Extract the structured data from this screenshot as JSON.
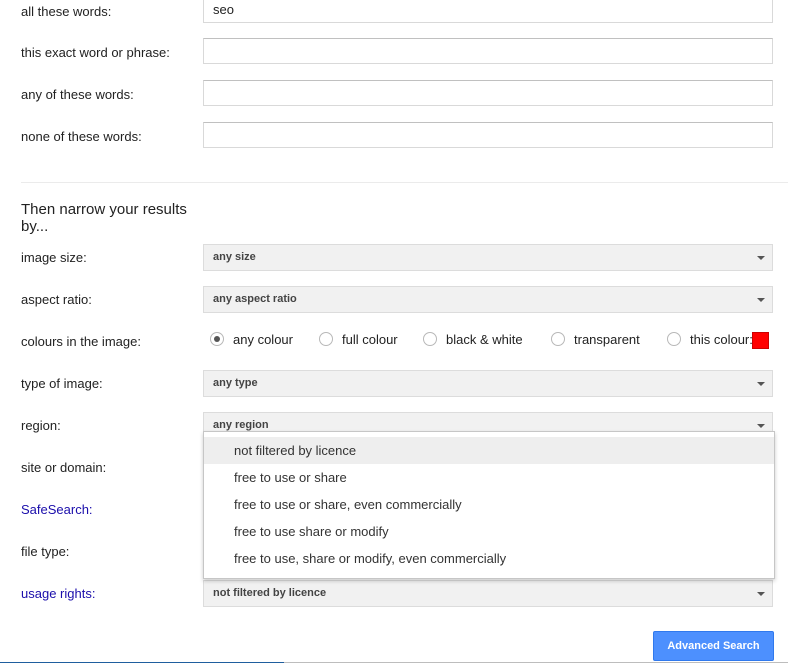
{
  "fields": {
    "all_words": {
      "label": "all these words:",
      "value": "seo"
    },
    "exact_phrase": {
      "label": "this exact word or phrase:",
      "value": ""
    },
    "any_words": {
      "label": "any of these words:",
      "value": ""
    },
    "none_words": {
      "label": "none of these words:",
      "value": ""
    }
  },
  "narrow_heading": "Then narrow your results by...",
  "image_size": {
    "label": "image size:",
    "selected": "any size"
  },
  "aspect_ratio": {
    "label": "aspect ratio:",
    "selected": "any aspect ratio"
  },
  "colours": {
    "label": "colours in the image:",
    "options": [
      "any colour",
      "full colour",
      "black & white",
      "transparent",
      "this colour:"
    ],
    "selected": "any colour",
    "swatch_color": "#ff0000"
  },
  "type_of_image": {
    "label": "type of image:",
    "selected": "any type"
  },
  "region": {
    "label": "region:",
    "selected": "any region"
  },
  "site_domain": {
    "label": "site or domain:"
  },
  "safesearch": {
    "label": "SafeSearch:"
  },
  "file_type": {
    "label": "file type:"
  },
  "usage_rights": {
    "label": "usage rights:",
    "selected": "not filtered by licence",
    "options": [
      "not filtered by licence",
      "free to use or share",
      "free to use or share, even commercially",
      "free to use share or modify",
      "free to use, share or modify, even commercially"
    ]
  },
  "submit_label": "Advanced Search",
  "colors": {
    "primary_button": "#4d90fe",
    "link": "#1a0dab"
  }
}
